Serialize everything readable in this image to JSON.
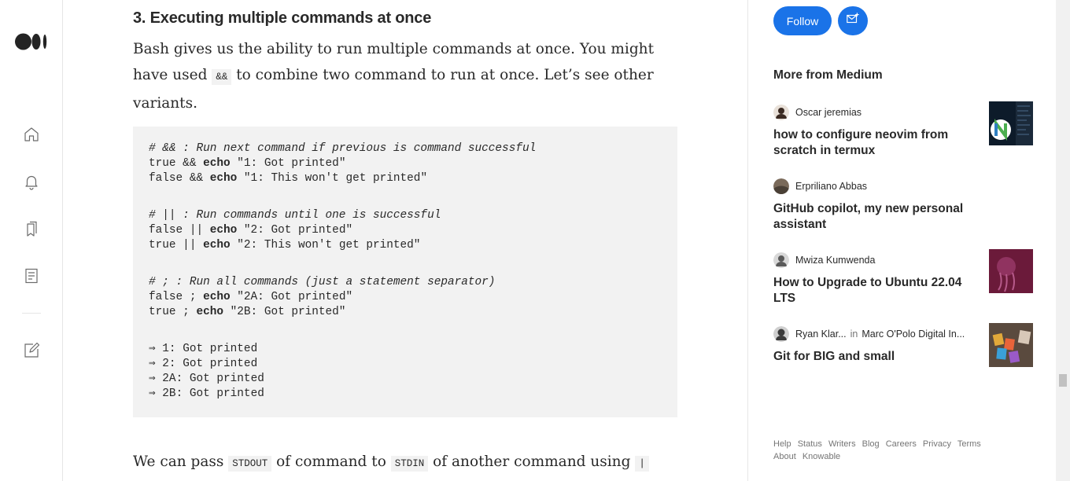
{
  "rail": {
    "logo": "medium-logo",
    "icons": [
      "home-icon",
      "bell-icon",
      "bookmarks-icon",
      "stories-icon",
      "write-icon"
    ]
  },
  "article": {
    "heading": "3. Executing multiple commands at once",
    "para1_part1": "Bash gives us the ability to run multiple commands at once. You might have used ",
    "para1_code": "&&",
    "para1_part2": " to combine two command to run at once. Let’s see other variants.",
    "code_lines": [
      {
        "type": "comment",
        "text": "# && : Run next command if previous is command successful"
      },
      {
        "type": "code",
        "pre": "true && ",
        "kw": "echo",
        "post": " \"1: Got printed\""
      },
      {
        "type": "code",
        "pre": "false && ",
        "kw": "echo",
        "post": " \"1: This won't get printed\""
      },
      {
        "type": "gap"
      },
      {
        "type": "comment",
        "text": "# || : Run commands until one is successful"
      },
      {
        "type": "code",
        "pre": "false || ",
        "kw": "echo",
        "post": " \"2: Got printed\""
      },
      {
        "type": "code",
        "pre": "true || ",
        "kw": "echo",
        "post": " \"2: This won't get printed\""
      },
      {
        "type": "gap"
      },
      {
        "type": "comment",
        "text": "# ; : Run all commands (just a statement separator)"
      },
      {
        "type": "code",
        "pre": "false ; ",
        "kw": "echo",
        "post": " \"2A: Got printed\""
      },
      {
        "type": "code",
        "pre": "true ; ",
        "kw": "echo",
        "post": " \"2B: Got printed\""
      },
      {
        "type": "gap"
      },
      {
        "type": "plain",
        "text": "⇒ 1: Got printed"
      },
      {
        "type": "plain",
        "text": "⇒ 2: Got printed"
      },
      {
        "type": "plain",
        "text": "⇒ 2A: Got printed"
      },
      {
        "type": "plain",
        "text": "⇒ 2B: Got printed"
      }
    ],
    "para2_part1": "We can pass ",
    "para2_code1": "STDOUT",
    "para2_part2": " of command to ",
    "para2_code2": "STDIN",
    "para2_part3": " of another command using ",
    "para2_code3": "|"
  },
  "sidebar": {
    "follow_label": "Follow",
    "subscribe_icon": "mail-plus-icon",
    "more_title": "More from Medium",
    "cards": [
      {
        "author": "Oscar jeremias",
        "publication": "",
        "in": "",
        "title": "how to configure neovim from scratch in termux",
        "has_thumb": true,
        "thumb": "neovim-logo"
      },
      {
        "author": "Erpriliano Abbas",
        "publication": "",
        "in": "",
        "title": "GitHub copilot, my new personal assistant",
        "has_thumb": false,
        "thumb": ""
      },
      {
        "author": "Mwiza Kumwenda",
        "publication": "",
        "in": "",
        "title": "How to Upgrade to Ubuntu 22.04 LTS",
        "has_thumb": true,
        "thumb": "ubuntu-jellyfish"
      },
      {
        "author": "Ryan Klar...",
        "publication": "Marc O'Polo Digital In...",
        "in": "in",
        "title": "Git for BIG and small",
        "has_thumb": true,
        "thumb": "git-letters"
      }
    ],
    "footer_links": [
      "Help",
      "Status",
      "Writers",
      "Blog",
      "Careers",
      "Privacy",
      "Terms",
      "About",
      "Knowable"
    ]
  },
  "colors": {
    "accent": "#1a73e8",
    "code_bg": "#f2f2f2",
    "text": "#292929",
    "muted": "#757575"
  }
}
